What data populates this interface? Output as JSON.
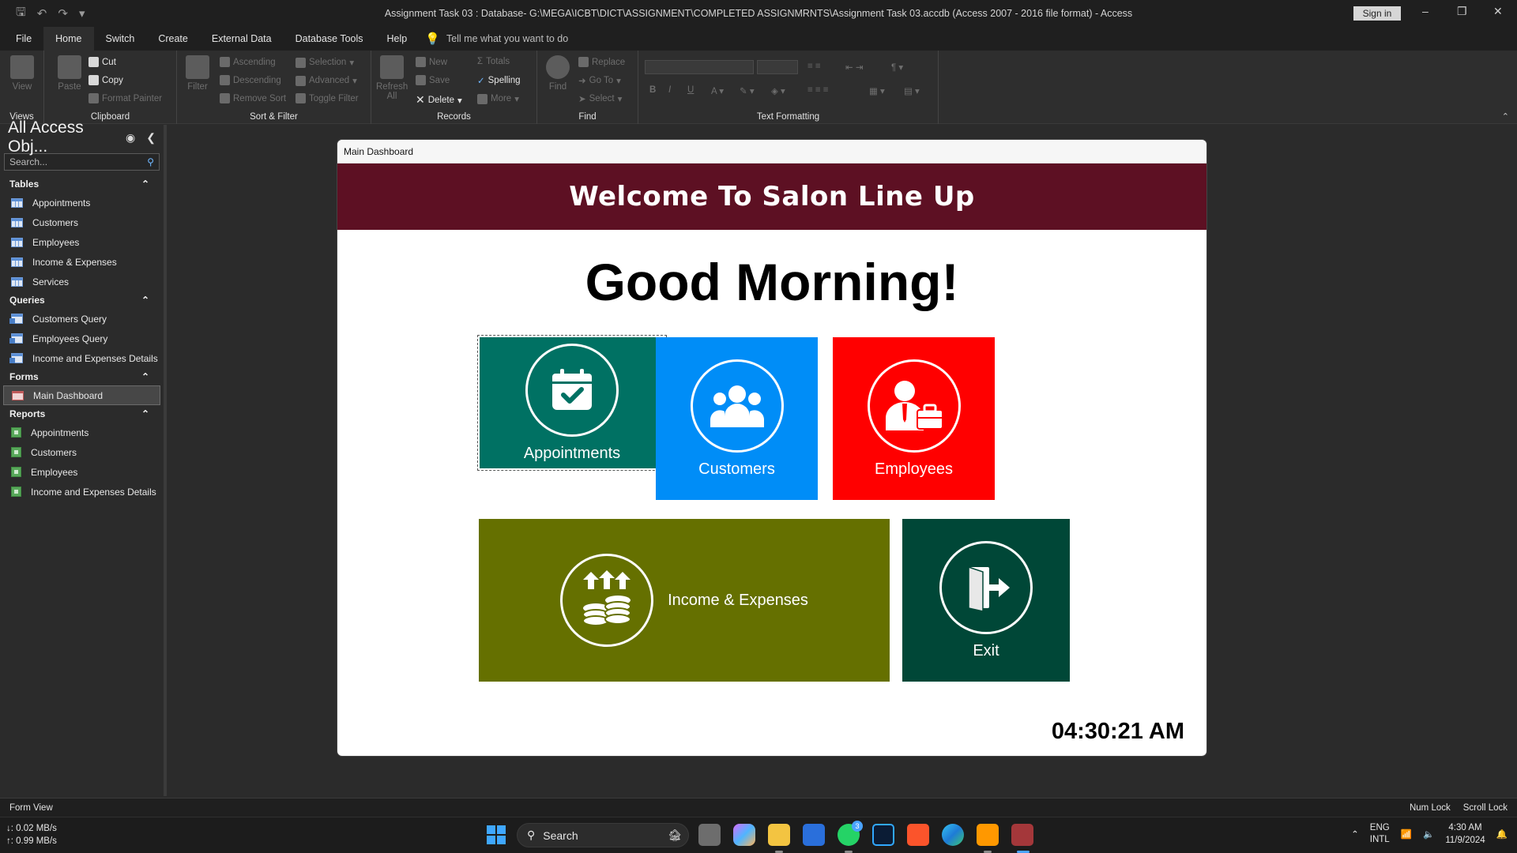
{
  "window": {
    "title": "Assignment Task 03 : Database- G:\\MEGA\\ICBT\\DICT\\ASSIGNMENT\\COMPLETED ASSIGNMRNTS\\Assignment Task 03.accdb (Access 2007 - 2016 file format)  -  Access",
    "sign_in": "Sign in"
  },
  "menu": {
    "items": [
      "File",
      "Home",
      "Switch",
      "Create",
      "External Data",
      "Database Tools",
      "Help"
    ],
    "active": "Home",
    "tell_me": "Tell me what you want to do"
  },
  "ribbon": {
    "views": {
      "label": "Views",
      "view": "View"
    },
    "clipboard": {
      "label": "Clipboard",
      "paste": "Paste",
      "cut": "Cut",
      "copy": "Copy",
      "format_painter": "Format Painter"
    },
    "sort_filter": {
      "label": "Sort & Filter",
      "filter": "Filter",
      "ascending": "Ascending",
      "descending": "Descending",
      "remove_sort": "Remove Sort",
      "selection": "Selection",
      "advanced": "Advanced",
      "toggle_filter": "Toggle Filter"
    },
    "records": {
      "label": "Records",
      "refresh_all": "Refresh All",
      "new": "New",
      "save": "Save",
      "delete": "Delete",
      "totals": "Totals",
      "spelling": "Spelling",
      "more": "More"
    },
    "find": {
      "label": "Find",
      "find": "Find",
      "replace": "Replace",
      "go_to": "Go To",
      "select": "Select"
    },
    "text_formatting": {
      "label": "Text Formatting",
      "bold": "B",
      "italic": "I",
      "underline": "U"
    }
  },
  "nav": {
    "title": "All Access Obj...",
    "search_placeholder": "Search...",
    "sections": [
      {
        "name": "Tables",
        "items": [
          "Appointments",
          "Customers",
          "Employees",
          "Income & Expenses",
          "Services"
        ]
      },
      {
        "name": "Queries",
        "items": [
          "Customers Query",
          "Employees Query",
          "Income and Expenses Details"
        ]
      },
      {
        "name": "Forms",
        "items": [
          "Main Dashboard"
        ]
      },
      {
        "name": "Reports",
        "items": [
          "Appointments",
          "Customers",
          "Employees",
          "Income and Expenses Details"
        ]
      }
    ],
    "selected": "Main Dashboard"
  },
  "form": {
    "window_title": "Main Dashboard",
    "banner": "Welcome To Salon Line Up",
    "greeting": "Good Morning!",
    "tiles": {
      "appointments": "Appointments",
      "customers": "Customers",
      "employees": "Employees",
      "income_expenses": "Income & Expenses",
      "exit": "Exit"
    },
    "clock": "04:30:21 AM"
  },
  "colors": {
    "banner": "#5d1023",
    "appointments": "#007163",
    "customers": "#008df7",
    "employees": "#ff0000",
    "income_expenses": "#657000",
    "exit": "#004737"
  },
  "status": {
    "left": "Form View",
    "num_lock": "Num Lock",
    "scroll_lock": "Scroll Lock"
  },
  "taskbar": {
    "net_down": "↓: 0.02 MB/s",
    "net_up": "↑: 0.99 MB/s",
    "search": "Search",
    "lang_1": "ENG",
    "lang_2": "INTL",
    "time": "4:30 AM",
    "date": "11/9/2024",
    "whatsapp_badge": "3"
  }
}
